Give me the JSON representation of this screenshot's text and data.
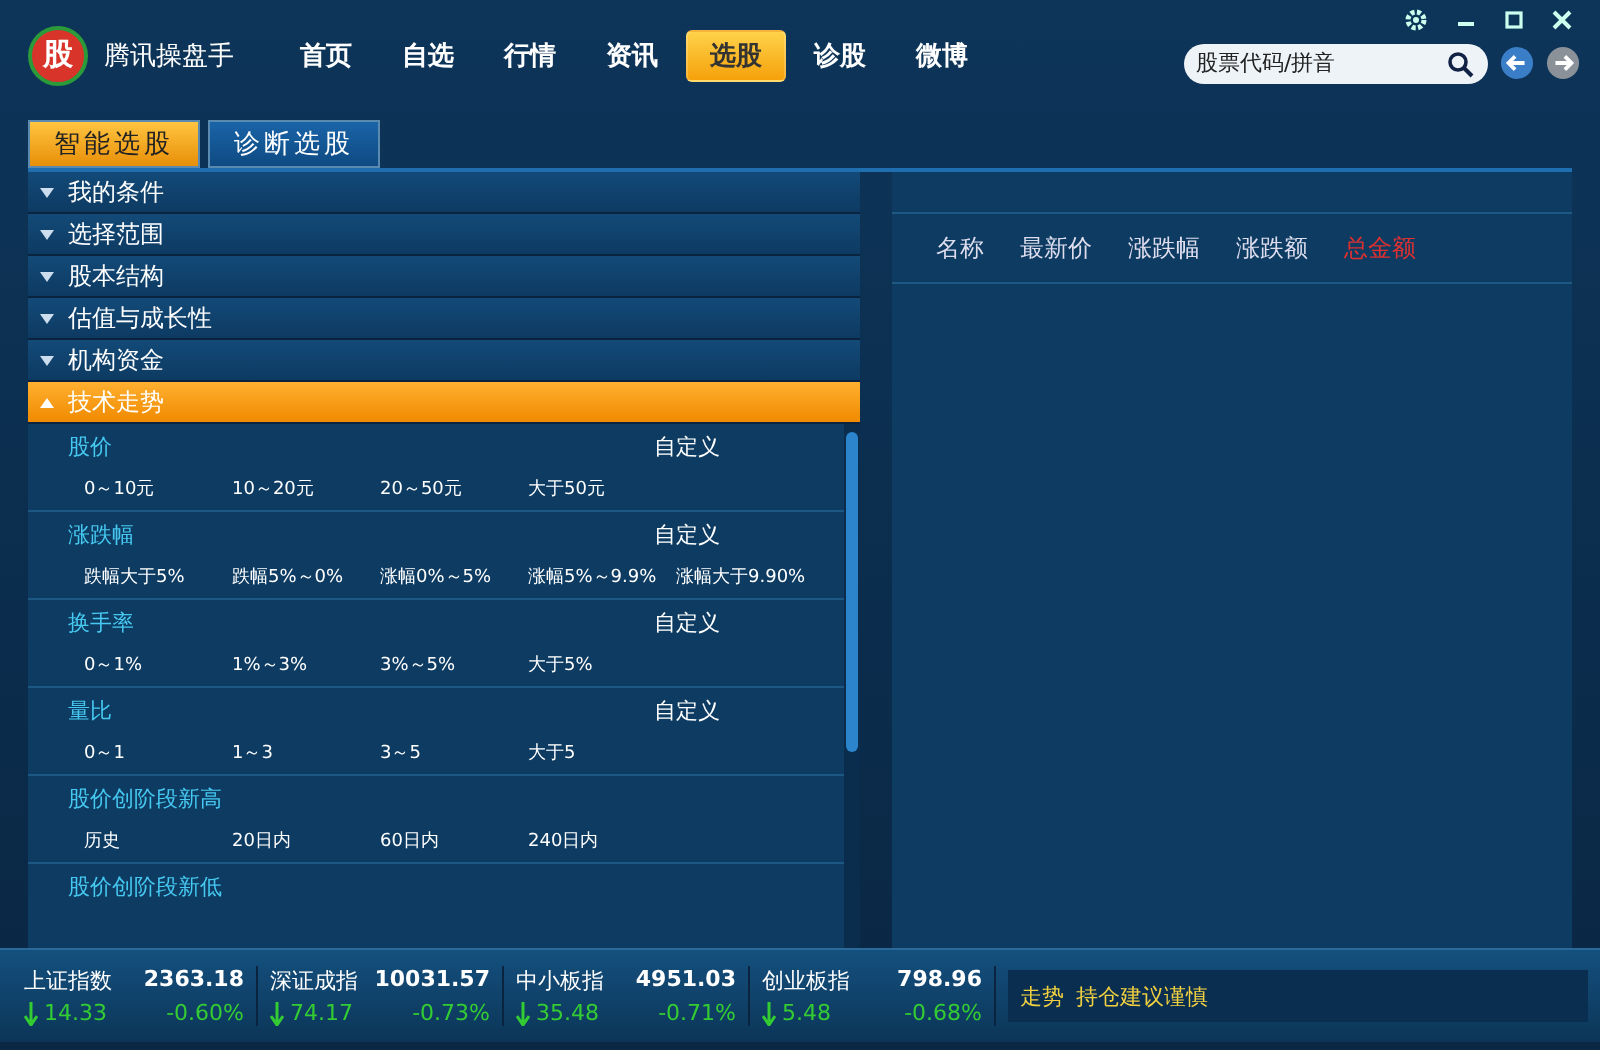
{
  "app": {
    "logo_char": "股",
    "title": "腾讯操盘手"
  },
  "nav": [
    {
      "label": "首页",
      "selected": false
    },
    {
      "label": "自选",
      "selected": false
    },
    {
      "label": "行情",
      "selected": false
    },
    {
      "label": "资讯",
      "selected": false
    },
    {
      "label": "选股",
      "selected": true
    },
    {
      "label": "诊股",
      "selected": false
    },
    {
      "label": "微博",
      "selected": false
    }
  ],
  "search": {
    "placeholder": "股票代码/拼音"
  },
  "tabs": [
    {
      "label": "智能选股",
      "selected": true
    },
    {
      "label": "诊断选股",
      "selected": false
    }
  ],
  "categories": [
    {
      "label": "我的条件",
      "expanded": false
    },
    {
      "label": "选择范围",
      "expanded": false
    },
    {
      "label": "股本结构",
      "expanded": false
    },
    {
      "label": "估值与成长性",
      "expanded": false
    },
    {
      "label": "机构资金",
      "expanded": false
    },
    {
      "label": "技术走势",
      "expanded": true
    }
  ],
  "sections": [
    {
      "title": "股价",
      "custom": "自定义",
      "options": [
        "0～10元",
        "10～20元",
        "20～50元",
        "大于50元"
      ]
    },
    {
      "title": "涨跌幅",
      "custom": "自定义",
      "options": [
        "跌幅大于5%",
        "跌幅5%～0%",
        "涨幅0%～5%",
        "涨幅5%～9.9%",
        "涨幅大于9.90%"
      ]
    },
    {
      "title": "换手率",
      "custom": "自定义",
      "options": [
        "0～1%",
        "1%～3%",
        "3%～5%",
        "大于5%"
      ]
    },
    {
      "title": "量比",
      "custom": "自定义",
      "options": [
        "0～1",
        "1～3",
        "3～5",
        "大于5"
      ]
    },
    {
      "title": "股价创阶段新高",
      "options": [
        "历史",
        "20日内",
        "60日内",
        "240日内"
      ]
    },
    {
      "title": "股价创阶段新低"
    }
  ],
  "table": {
    "columns": [
      {
        "label": "名称",
        "selected": false
      },
      {
        "label": "最新价",
        "selected": false
      },
      {
        "label": "涨跌幅",
        "selected": false
      },
      {
        "label": "涨跌额",
        "selected": false
      },
      {
        "label": "总金额",
        "selected": true
      }
    ]
  },
  "indices": [
    {
      "name": "上证指数",
      "value": "2363.18",
      "change": "14.33",
      "percent": "-0.60%"
    },
    {
      "name": "深证成指",
      "value": "10031.57",
      "change": "74.17",
      "percent": "-0.73%"
    },
    {
      "name": "中小板指",
      "value": "4951.03",
      "change": "35.48",
      "percent": "-0.71%"
    },
    {
      "name": "创业板指",
      "value": "798.96",
      "change": "5.48",
      "percent": "-0.68%"
    }
  ],
  "advice": {
    "label": "走势",
    "text": "持仓建议谨慎"
  }
}
